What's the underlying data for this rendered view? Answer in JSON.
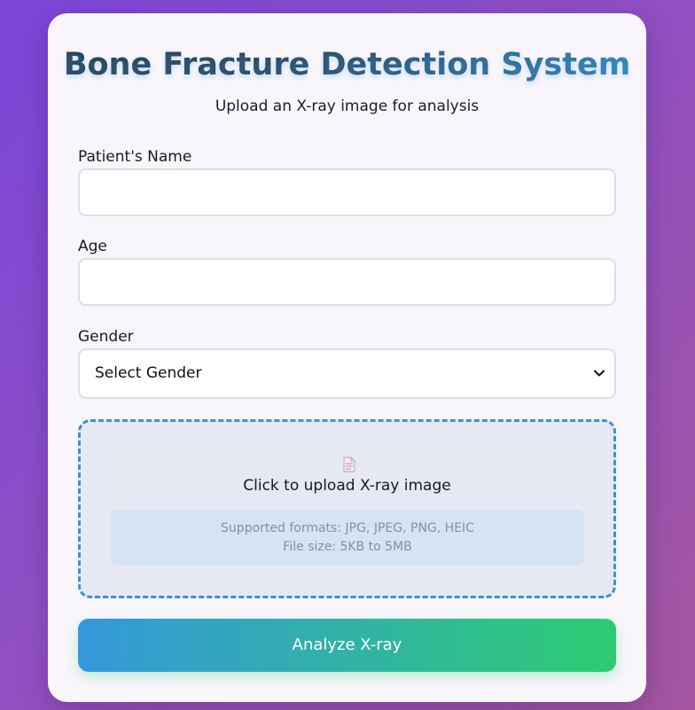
{
  "header": {
    "title": "Bone Fracture Detection System",
    "subtitle": "Upload an X-ray image for analysis"
  },
  "form": {
    "name": {
      "label": "Patient's Name",
      "value": "",
      "placeholder": ""
    },
    "age": {
      "label": "Age",
      "value": "",
      "placeholder": ""
    },
    "gender": {
      "label": "Gender",
      "selected": "Select Gender",
      "icon": "chevron-down-icon"
    },
    "upload": {
      "icon": "document-icon",
      "prompt": "Click to upload X-ray image",
      "formats": "Supported formats: JPG, JPEG, PNG, HEIC",
      "size": "File size: 5KB to 5MB"
    },
    "submit_label": "Analyze X-ray"
  },
  "colors": {
    "background_start": "#7b45d9",
    "background_end": "#a4569f",
    "card": "#f8f6fb",
    "accent_blue": "#3498db",
    "accent_green": "#2ecc71",
    "upload_border": "#3a93cc"
  }
}
